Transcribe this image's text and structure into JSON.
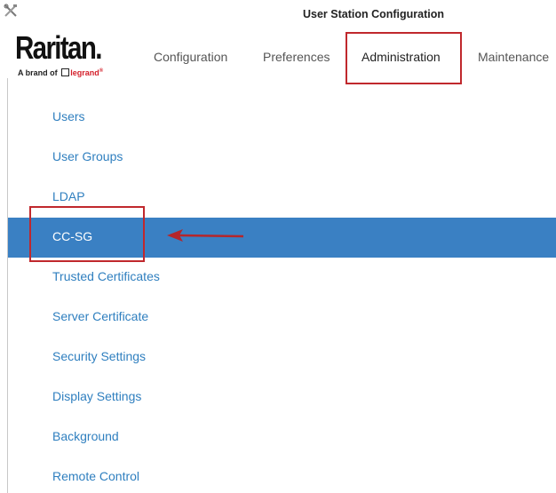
{
  "window": {
    "title": "User Station Configuration",
    "icon": "tools-icon"
  },
  "logo": {
    "name": "Raritan.",
    "tagline_prefix": "A brand of",
    "tagline_brand": "legrand"
  },
  "nav": {
    "tabs": [
      {
        "label": "Configuration"
      },
      {
        "label": "Preferences"
      },
      {
        "label": "Administration",
        "active": true
      },
      {
        "label": "Maintenance"
      }
    ]
  },
  "menu": {
    "items": [
      {
        "label": "Users"
      },
      {
        "label": "User Groups"
      },
      {
        "label": "LDAP"
      },
      {
        "label": "CC-SG",
        "selected": true
      },
      {
        "label": "Trusted Certificates"
      },
      {
        "label": "Server Certificate"
      },
      {
        "label": "Security Settings"
      },
      {
        "label": "Display Settings"
      },
      {
        "label": "Background"
      },
      {
        "label": "Remote Control"
      }
    ]
  },
  "colors": {
    "accent": "#3a80c3",
    "link": "#2f7fbf",
    "annotation": "#c0282d"
  }
}
